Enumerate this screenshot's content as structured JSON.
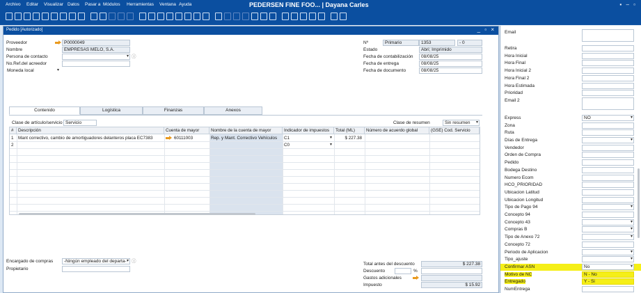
{
  "menu": [
    "Archivo",
    "Editar",
    "Visualizar",
    "Datos",
    "Pasar a",
    "Módulos",
    "Herramientas",
    "Ventana",
    "Ayuda"
  ],
  "app_title": "PEDERSEN FINE FOO... | Dayana Carles",
  "window_controls": "▪ – ▫",
  "doc_title": "Pedido [Autorizado]",
  "doc_controls": "_ ▫ ×",
  "header_left": {
    "proveedor_label": "Proveedor",
    "proveedor_value": "P0000049",
    "nombre_label": "Nombre",
    "nombre_value": "EMPRESAS MELO, S.A.",
    "contacto_label": "Persona de contacto",
    "ref_label": "No.Ref.del acreedor",
    "moneda_label": "Moneda local"
  },
  "header_right": {
    "no_label": "Nº",
    "no_series": "Primario",
    "no_value": "1353",
    "no_suffix": "- 0",
    "estado_label": "Estado",
    "estado_value": "Abri; Imprimido",
    "fcont_label": "Fecha de contabilización",
    "fcont_value": "08/08/25",
    "fent_label": "Fecha de entrega",
    "fent_value": "08/08/25",
    "fdoc_label": "Fecha de documento",
    "fdoc_value": "08/08/25"
  },
  "tabs": [
    "Contenido",
    "Logística",
    "Finanzas",
    "Anexos"
  ],
  "content": {
    "clase_label": "Clase de artículo/servicio",
    "clase_value": "Servicio",
    "resumen_label": "Clase de resumen",
    "resumen_value": "Sin resumen"
  },
  "grid": {
    "headers": [
      "#",
      "Descripción",
      "Cuenta de mayor",
      "Nombre de la cuenta de mayor",
      "Indicador de impuestos",
      "Total (ML)",
      "Número de acuerdo global",
      "(GSE) Cod. Servicio"
    ],
    "rows": [
      {
        "num": "1",
        "desc": "Mant correctivo, cambio de amortiguadores delanteros placa EC7383",
        "cuenta": "60111003",
        "nombre": "Rep. y Mant. Correctivo Vehículos",
        "impuesto": "C1",
        "total": "$ 227.38"
      },
      {
        "num": "2",
        "desc": "",
        "cuenta": "",
        "nombre": "",
        "impuesto": "C0",
        "total": ""
      }
    ]
  },
  "footer_left": {
    "comprador_label": "Encargado de compras",
    "comprador_value": "-Ningún empleado del departa-",
    "propietario_label": "Propietario"
  },
  "totals": {
    "antes_label": "Total antes del descuento",
    "antes_value": "$ 227.38",
    "descuento_label": "Descuento",
    "pct": "%",
    "gastos_label": "Gastos adicionales",
    "impuesto_label": "Impuesto",
    "impuesto_value": "$ 15.92"
  },
  "udf": [
    {
      "label": "Email",
      "value": "",
      "tall": true
    },
    {
      "label": "Retira",
      "value": ""
    },
    {
      "label": "Hora Inicial",
      "value": ""
    },
    {
      "label": "Hora Final",
      "value": ""
    },
    {
      "label": "Hora Inicial 2",
      "value": ""
    },
    {
      "label": "Hora Final 2",
      "value": ""
    },
    {
      "label": "Hora Estimada",
      "value": ""
    },
    {
      "label": "Prioridad",
      "value": ""
    },
    {
      "label": "Email 2",
      "value": "",
      "tall": true
    },
    {
      "label": "Express",
      "value": "NO",
      "dropdown": true
    },
    {
      "label": "Zona",
      "value": ""
    },
    {
      "label": "Ruta",
      "value": ""
    },
    {
      "label": "Días de Entrega",
      "value": "",
      "dropdown": true
    },
    {
      "label": "Vendedor",
      "value": ""
    },
    {
      "label": "Orden de Compra",
      "value": ""
    },
    {
      "label": "Pedido",
      "value": ""
    },
    {
      "label": "Bodega Destino",
      "value": ""
    },
    {
      "label": "Numero Ecom",
      "value": ""
    },
    {
      "label": "HCO_PRIORIDAD",
      "value": ""
    },
    {
      "label": "Ubicacion Latitud",
      "value": ""
    },
    {
      "label": "Ubicacion Longitud",
      "value": ""
    },
    {
      "label": "Tipo de Pago 94",
      "value": "",
      "dropdown": true
    },
    {
      "label": "Concepto 94",
      "value": ""
    },
    {
      "label": "Concepto 43",
      "value": "",
      "dropdown": true
    },
    {
      "label": "Compras B",
      "value": "",
      "dropdown": true
    },
    {
      "label": "Tipo de Anexo 72",
      "value": "",
      "dropdown": true
    },
    {
      "label": "Concepto 72",
      "value": ""
    },
    {
      "label": "Periodo de Aplicacion",
      "value": "",
      "dropdown": true
    },
    {
      "label": "Tipo_ajuste",
      "value": "",
      "dropdown": true
    },
    {
      "label": "Confirmar ASN",
      "value": "No",
      "dropdown": true,
      "highlight": true
    },
    {
      "label": "Motivo de NC",
      "value": "",
      "option": "N - No"
    },
    {
      "label": "Entregado",
      "value": "",
      "option": "Y - Si"
    },
    {
      "label": "NumEntrega",
      "value": ""
    }
  ]
}
